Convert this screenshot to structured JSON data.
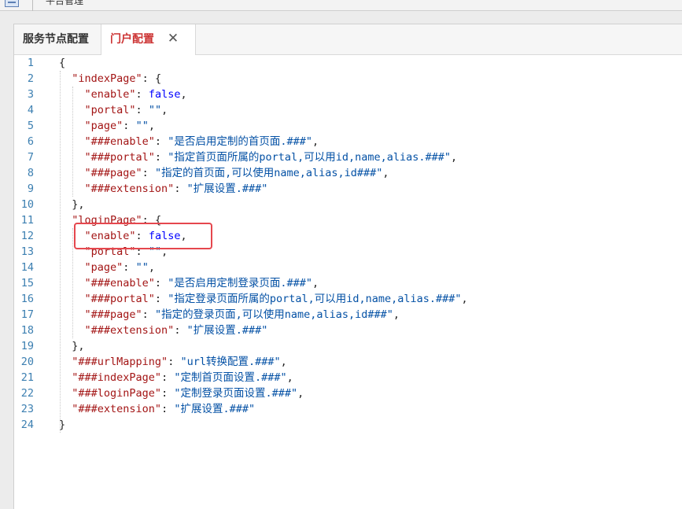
{
  "window": {
    "breadcrumb": "平台管理"
  },
  "tabs": [
    {
      "label": "服务节点配置",
      "active": false
    },
    {
      "label": "门户配置",
      "active": true,
      "close": "✕"
    }
  ],
  "editor": {
    "lines": [
      {
        "n": "1",
        "text": "{"
      },
      {
        "n": "2",
        "text": "  \"indexPage\": {"
      },
      {
        "n": "3",
        "text": "    \"enable\": false,"
      },
      {
        "n": "4",
        "text": "    \"portal\": \"\","
      },
      {
        "n": "5",
        "text": "    \"page\": \"\","
      },
      {
        "n": "6",
        "text": "    \"###enable\": \"是否启用定制的首页面.###\","
      },
      {
        "n": "7",
        "text": "    \"###portal\": \"指定首页面所属的portal,可以用id,name,alias.###\","
      },
      {
        "n": "8",
        "text": "    \"###page\": \"指定的首页面,可以使用name,alias,id###\","
      },
      {
        "n": "9",
        "text": "    \"###extension\": \"扩展设置.###\""
      },
      {
        "n": "10",
        "text": "  },"
      },
      {
        "n": "11",
        "text": "  \"loginPage\": {"
      },
      {
        "n": "12",
        "text": "    \"enable\": false,"
      },
      {
        "n": "13",
        "text": "    \"portal\": \"\","
      },
      {
        "n": "14",
        "text": "    \"page\": \"\","
      },
      {
        "n": "15",
        "text": "    \"###enable\": \"是否启用定制登录页面.###\","
      },
      {
        "n": "16",
        "text": "    \"###portal\": \"指定登录页面所属的portal,可以用id,name,alias.###\","
      },
      {
        "n": "17",
        "text": "    \"###page\": \"指定的登录页面,可以使用name,alias,id###\","
      },
      {
        "n": "18",
        "text": "    \"###extension\": \"扩展设置.###\""
      },
      {
        "n": "19",
        "text": "  },"
      },
      {
        "n": "20",
        "text": "  \"###urlMapping\": \"url转换配置.###\","
      },
      {
        "n": "21",
        "text": "  \"###indexPage\": \"定制首页面设置.###\","
      },
      {
        "n": "22",
        "text": "  \"###loginPage\": \"定制登录页面设置.###\","
      },
      {
        "n": "23",
        "text": "  \"###extension\": \"扩展设置.###\""
      },
      {
        "n": "24",
        "text": "}"
      }
    ]
  },
  "colors": {
    "active_tab_text": "#cc3333",
    "highlight_border": "#e5474e",
    "line_number": "#3c7fb1",
    "key": "#a31515",
    "string": "#0451a5",
    "literal": "#0000ff"
  }
}
